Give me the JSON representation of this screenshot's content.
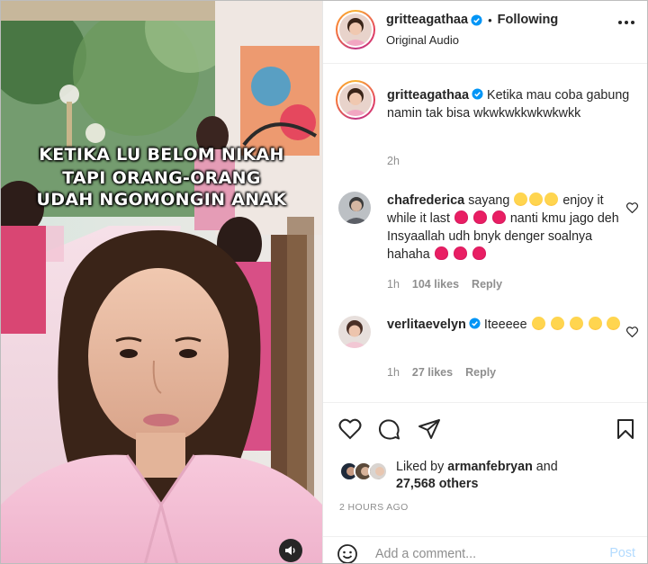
{
  "media": {
    "overlay_lines": [
      "KETIKA LU BELOM NIKAH",
      "TAPI ORANG-ORANG",
      "UDAH NGOMONGIN ANAK"
    ],
    "audio_icon": "speaker-icon"
  },
  "header": {
    "username": "gritteagathaa",
    "separator": "•",
    "follow_state": "Following",
    "subtitle": "Original Audio",
    "more_icon": "more-options-icon"
  },
  "caption": {
    "username": "gritteagathaa",
    "text": "Ketika mau coba gabung namin tak bisa wkwkwkkwkwkwkk",
    "time": "2h"
  },
  "comments": [
    {
      "username": "chafrederica",
      "text_parts": [
        "sayang",
        " enjoy it while it last ",
        " nanti kmu jago deh Insyaallah udh bnyk denger soalnya hahaha "
      ],
      "time": "1h",
      "likes": "104 likes",
      "reply": "Reply",
      "verified": false
    },
    {
      "username": "verlitaevelyn",
      "text_parts": [
        "Iteeeee"
      ],
      "time": "1h",
      "likes": "27 likes",
      "reply": "Reply",
      "verified": true
    }
  ],
  "actions": {
    "liked_prefix": "Liked by",
    "liked_user": "armanfebryan",
    "liked_and": "and",
    "liked_others": "27,568 others",
    "post_time": "2 HOURS AGO"
  },
  "add_comment": {
    "placeholder": "Add a comment...",
    "post_label": "Post"
  },
  "colors": {
    "verified_blue": "#0095f6",
    "post_disabled": "#b3dbff",
    "muted": "#8e8e8e"
  }
}
